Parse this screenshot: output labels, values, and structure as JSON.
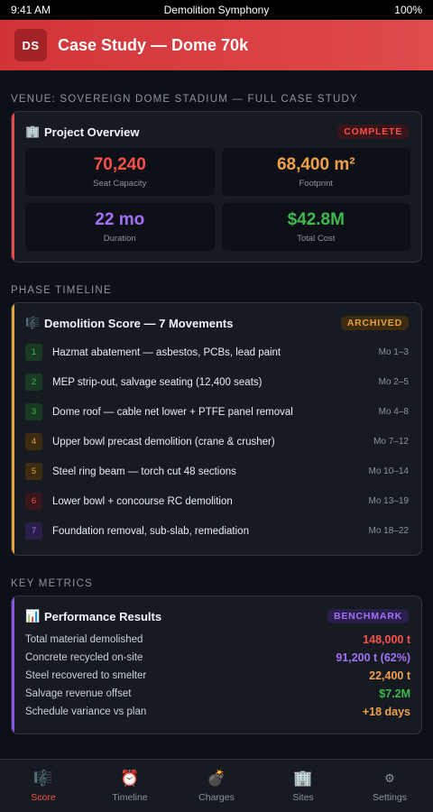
{
  "status_bar": {
    "time": "9:41 AM",
    "title": "Demolition Symphony",
    "battery": "100%"
  },
  "header": {
    "logo": "DS",
    "title": "Case Study — Dome 70k"
  },
  "venue_label": "Venue: Sovereign Dome Stadium — Full Case Study",
  "overview": {
    "icon": "🏢",
    "title": "Project Overview",
    "badge": "COMPLETE",
    "stats": [
      {
        "value": "70,240",
        "label": "Seat Capacity",
        "color": "#f85149"
      },
      {
        "value": "68,400 m²",
        "label": "Footprint",
        "color": "#f0a04b"
      },
      {
        "value": "22 mo",
        "label": "Duration",
        "color": "#a371f7"
      },
      {
        "value": "$42.8M",
        "label": "Total Cost",
        "color": "#3fb950"
      }
    ]
  },
  "timeline_label": "Phase Timeline",
  "timeline": {
    "icon": "🎼",
    "title": "Demolition Score — 7 Movements",
    "badge": "ARCHIVED",
    "phases": [
      {
        "num": "1",
        "text": "Hazmat abatement — asbestos, PCBs, lead paint",
        "when": "Mo 1–3",
        "bg": "#1b3a24",
        "fg": "#3fb950"
      },
      {
        "num": "2",
        "text": "MEP strip-out, salvage seating (12,400 seats)",
        "when": "Mo 2–5",
        "bg": "#1b3a24",
        "fg": "#3fb950"
      },
      {
        "num": "3",
        "text": "Dome roof — cable net lower + PTFE panel removal",
        "when": "Mo 4–8",
        "bg": "#1b3a24",
        "fg": "#3fb950"
      },
      {
        "num": "4",
        "text": "Upper bowl precast demolition (crane & crusher)",
        "when": "Mo 7–12",
        "bg": "#3d2c12",
        "fg": "#e3a33b"
      },
      {
        "num": "5",
        "text": "Steel ring beam — torch cut 48 sections",
        "when": "Mo 10–14",
        "bg": "#3d2c12",
        "fg": "#e3a33b"
      },
      {
        "num": "6",
        "text": "Lower bowl + concourse RC demolition",
        "when": "Mo 13–19",
        "bg": "#3a1519",
        "fg": "#f85149"
      },
      {
        "num": "7",
        "text": "Foundation removal, sub-slab, remediation",
        "when": "Mo 18–22",
        "bg": "#2a1f4a",
        "fg": "#a371f7"
      }
    ]
  },
  "metrics_label": "Key Metrics",
  "performance": {
    "icon": "📊",
    "title": "Performance Results",
    "badge": "BENCHMARK",
    "rows": [
      {
        "label": "Total material demolished",
        "value": "148,000 t",
        "color": "#f85149"
      },
      {
        "label": "Concrete recycled on-site",
        "value": "91,200 t (62%)",
        "color": "#a371f7"
      },
      {
        "label": "Steel recovered to smelter",
        "value": "22,400 t",
        "color": "#f0a04b"
      },
      {
        "label": "Salvage revenue offset",
        "value": "$7.2M",
        "color": "#3fb950"
      },
      {
        "label": "Schedule variance vs plan",
        "value": "+18 days",
        "color": "#f0a04b"
      }
    ]
  },
  "tabs": [
    {
      "icon": "🎼",
      "icon_name": "score-icon",
      "label": "Score",
      "active": true
    },
    {
      "icon": "⏰",
      "icon_name": "alarm-clock-icon",
      "label": "Timeline",
      "active": false
    },
    {
      "icon": "💣",
      "icon_name": "bomb-icon",
      "label": "Charges",
      "active": false
    },
    {
      "icon": "🏢",
      "icon_name": "building-icon",
      "label": "Sites",
      "active": false
    },
    {
      "icon": "⚙",
      "icon_name": "gear-icon",
      "label": "Settings",
      "active": false
    }
  ]
}
